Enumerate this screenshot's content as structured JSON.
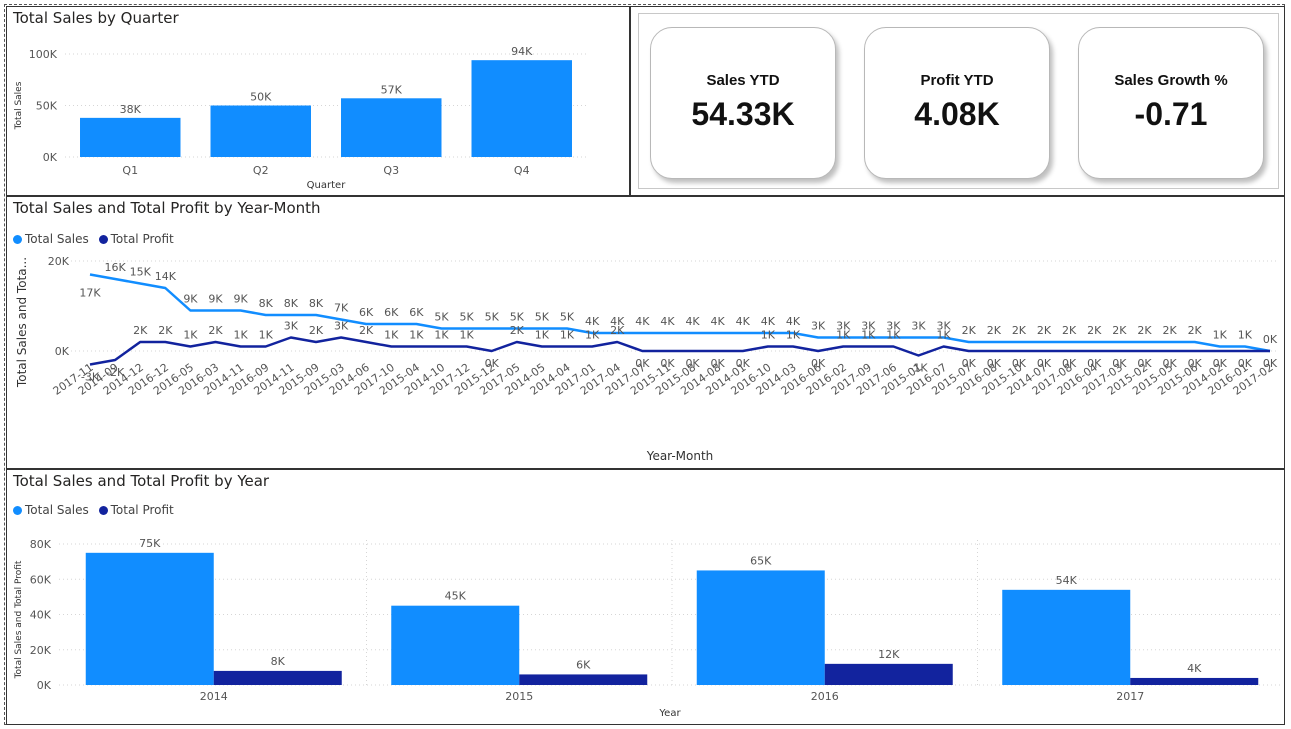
{
  "colors": {
    "sales": "#118DFF",
    "profit": "#12239E"
  },
  "quarter_chart": {
    "title": "Total Sales by Quarter",
    "chart_data": {
      "type": "bar",
      "title": "Total Sales by Quarter",
      "xlabel": "Quarter",
      "ylabel": "Total Sales",
      "categories": [
        "Q1",
        "Q2",
        "Q3",
        "Q4"
      ],
      "values": [
        38000,
        50000,
        57000,
        94000
      ],
      "data_labels": [
        "38K",
        "50K",
        "57K",
        "94K"
      ],
      "yticks": [
        "0K",
        "50K",
        "100K"
      ],
      "ylim": [
        0,
        100000
      ],
      "grid": true
    }
  },
  "kpis": [
    {
      "label": "Sales YTD",
      "value": "54.33K"
    },
    {
      "label": "Profit YTD",
      "value": "4.08K"
    },
    {
      "label": "Sales Growth %",
      "value": "-0.71"
    }
  ],
  "month_chart": {
    "title": "Total Sales and Total Profit by Year-Month",
    "legend": [
      "Total Sales",
      "Total Profit"
    ],
    "chart_data": {
      "type": "line",
      "title": "Total Sales and Total Profit by Year-Month",
      "xlabel": "Year-Month",
      "ylabel": "Total Sales and Tota...",
      "yticks": [
        "0K",
        "20K"
      ],
      "ylim": [
        -4000,
        21000
      ],
      "legend_position": "top-left",
      "categories": [
        "2017-11",
        "2014-09",
        "2014-12",
        "2016-12",
        "2016-05",
        "2016-03",
        "2014-11",
        "2016-09",
        "2014-11",
        "2015-09",
        "2015-03",
        "2014-06",
        "2017-10",
        "2015-04",
        "2014-10",
        "2017-12",
        "2015-12",
        "2017-05",
        "2014-05",
        "2014-04",
        "2017-01",
        "2017-04",
        "2017-07",
        "2015-11",
        "2015-08",
        "2014-08",
        "2014-01",
        "2016-10",
        "2014-03",
        "2016-06",
        "2016-02",
        "2017-09",
        "2017-06",
        "2015-01",
        "2016-07",
        "2015-07",
        "2016-08",
        "2015-10",
        "2014-07",
        "2017-08",
        "2016-04",
        "2017-03",
        "2015-02",
        "2015-05",
        "2015-06",
        "2014-02",
        "2016-01",
        "2017-02"
      ],
      "series": [
        {
          "name": "Total Sales",
          "values": [
            17000,
            16000,
            15000,
            14000,
            9000,
            9000,
            9000,
            8000,
            8000,
            8000,
            7000,
            6000,
            6000,
            6000,
            5000,
            5000,
            5000,
            5000,
            5000,
            5000,
            4000,
            4000,
            4000,
            4000,
            4000,
            4000,
            4000,
            4000,
            4000,
            3000,
            3000,
            3000,
            3000,
            3000,
            3000,
            2000,
            2000,
            2000,
            2000,
            2000,
            2000,
            2000,
            2000,
            2000,
            2000,
            1000,
            1000,
            0
          ],
          "labels": [
            "17K",
            "16K",
            "15K",
            "14K",
            "9K",
            "9K",
            "9K",
            "8K",
            "8K",
            "8K",
            "7K",
            "6K",
            "6K",
            "6K",
            "5K",
            "5K",
            "5K",
            "5K",
            "5K",
            "5K",
            "4K",
            "4K",
            "4K",
            "4K",
            "4K",
            "4K",
            "4K",
            "4K",
            "4K",
            "3K",
            "3K",
            "3K",
            "3K",
            "3K",
            "3K",
            "2K",
            "2K",
            "2K",
            "2K",
            "2K",
            "2K",
            "2K",
            "2K",
            "2K",
            "2K",
            "1K",
            "1K",
            "0K"
          ]
        },
        {
          "name": "Total Profit",
          "values": [
            -3000,
            -2000,
            2000,
            2000,
            1000,
            2000,
            1000,
            1000,
            3000,
            2000,
            3000,
            2000,
            1000,
            1000,
            1000,
            1000,
            0,
            2000,
            1000,
            1000,
            1000,
            2000,
            0,
            0,
            0,
            0,
            0,
            1000,
            1000,
            0,
            1000,
            1000,
            1000,
            -1000,
            1000,
            0,
            0,
            0,
            0,
            0,
            0,
            0,
            0,
            0,
            0,
            0,
            0,
            0
          ],
          "labels": [
            "-3K",
            "-2K",
            "2K",
            "2K",
            "1K",
            "2K",
            "1K",
            "1K",
            "3K",
            "2K",
            "3K",
            "2K",
            "1K",
            "1K",
            "1K",
            "1K",
            "0K",
            "2K",
            "1K",
            "1K",
            "1K",
            "2K",
            "0K",
            "0K",
            "0K",
            "0K",
            "0K",
            "1K",
            "1K",
            "0K",
            "1K",
            "1K",
            "1K",
            "-1K",
            "1K",
            "0K",
            "0K",
            "0K",
            "0K",
            "0K",
            "0K",
            "0K",
            "0K",
            "0K",
            "0K",
            "0K",
            "0K",
            "0K"
          ]
        }
      ]
    }
  },
  "year_chart": {
    "title": "Total Sales and Total Profit by Year",
    "legend": [
      "Total Sales",
      "Total Profit"
    ],
    "chart_data": {
      "type": "bar",
      "title": "Total Sales and Total Profit by Year",
      "xlabel": "Year",
      "ylabel": "Total Sales and Total Profit",
      "categories": [
        "2014",
        "2015",
        "2016",
        "2017"
      ],
      "yticks": [
        "0K",
        "20K",
        "40K",
        "60K",
        "80K"
      ],
      "ylim": [
        0,
        80000
      ],
      "legend_position": "top-left",
      "series": [
        {
          "name": "Total Sales",
          "values": [
            75000,
            45000,
            65000,
            54000
          ],
          "labels": [
            "75K",
            "45K",
            "65K",
            "54K"
          ]
        },
        {
          "name": "Total Profit",
          "values": [
            8000,
            6000,
            12000,
            4000
          ],
          "labels": [
            "8K",
            "6K",
            "12K",
            "4K"
          ]
        }
      ]
    }
  }
}
